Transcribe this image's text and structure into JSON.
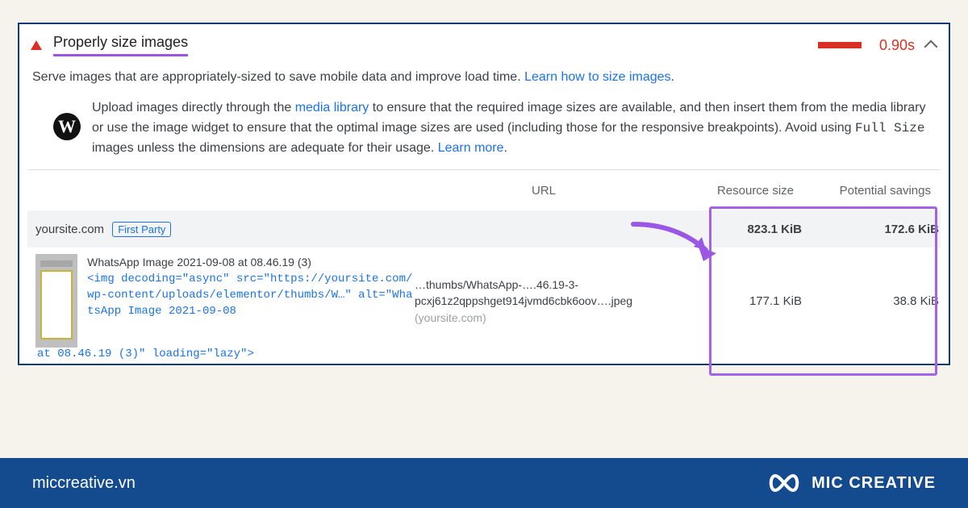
{
  "audit": {
    "title": "Properly size images",
    "time": "0.90s",
    "description_pre": "Serve images that are appropriately-sized to save mobile data and improve load time. ",
    "description_link": "Learn how to size images",
    "wp_text_1": "Upload images directly through the ",
    "wp_link": "media library",
    "wp_text_2": " to ensure that the required image sizes are available, and then insert them from the media library or use the image widget to ensure that the optimal image sizes are used (including those for the responsive breakpoints). Avoid using ",
    "wp_code": "Full Size",
    "wp_text_3": " images unless the dimensions are adequate for their usage. ",
    "wp_learn": "Learn more"
  },
  "table": {
    "headers": {
      "url": "URL",
      "resource_size": "Resource size",
      "potential_savings": "Potential savings"
    },
    "summary": {
      "host": "yoursite.com",
      "badge": "First Party",
      "resource_size": "823.1 KiB",
      "potential_savings": "172.6 KiB"
    },
    "rows": [
      {
        "title": "WhatsApp Image 2021-09-08 at 08.46.19 (3)",
        "code": "<img decoding=\"async\" src=\"https://yoursite.com/wp-content/uploads/elementor/thumbs/W…\" alt=\"WhatsApp Image 2021-09-08",
        "code_overflow": "at 08.46.19 (3)\" loading=\"lazy\">",
        "url_text": "…thumbs/WhatsApp-….46.19-3-pcxj61z2qppshget914jvmd6cbk6oov….jpeg",
        "url_host": "(yoursite.com)",
        "resource_size": "177.1 KiB",
        "potential_savings": "38.8 KiB"
      }
    ]
  },
  "footer": {
    "site": "miccreative.vn",
    "brand": "MIC CREATIVE"
  }
}
